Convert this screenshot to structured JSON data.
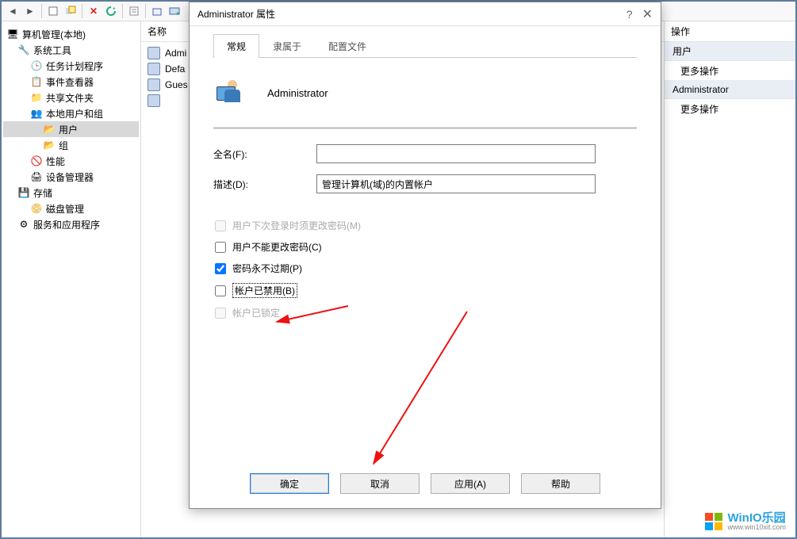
{
  "toolbar_icons": [
    "nav-back",
    "nav-fwd",
    "new",
    "overlay",
    "delete",
    "refresh",
    "prop",
    "export",
    "view",
    "help"
  ],
  "tree": {
    "root": "算机管理(本地)",
    "items": [
      {
        "label": "系统工具",
        "icon": "tools"
      },
      {
        "label": "任务计划程序",
        "icon": "clock"
      },
      {
        "label": "事件查看器",
        "icon": "event"
      },
      {
        "label": "共享文件夹",
        "icon": "share"
      },
      {
        "label": "本地用户和组",
        "icon": "users"
      },
      {
        "label": "用户",
        "icon": "folder",
        "selected": true
      },
      {
        "label": "组",
        "icon": "folder"
      },
      {
        "label": "性能",
        "icon": "perf"
      },
      {
        "label": "设备管理器",
        "icon": "device"
      },
      {
        "label": "存储",
        "icon": "storage"
      },
      {
        "label": "磁盘管理",
        "icon": "disk"
      },
      {
        "label": "服务和应用程序",
        "icon": "service"
      }
    ]
  },
  "center": {
    "header": "名称",
    "rows": [
      "Admi",
      "Defa",
      "Gues",
      ""
    ]
  },
  "right": {
    "header": "操作",
    "sec1": "用户",
    "link1": "更多操作",
    "sec2": "Administrator",
    "link2": "更多操作"
  },
  "dialog": {
    "title": "Administrator 属性",
    "tabs": [
      "常规",
      "隶属于",
      "配置文件"
    ],
    "active_tab": 0,
    "heading": "Administrator",
    "fields": {
      "fullname_label": "全名(F):",
      "fullname": "",
      "desc_label": "描述(D):",
      "desc": "管理计算机(域)的内置帐户"
    },
    "checks": {
      "c1": "用户下次登录时须更改密码(M)",
      "c2": "用户不能更改密码(C)",
      "c3": "密码永不过期(P)",
      "c4": "帐户已禁用(B)",
      "c5": "帐户已锁定"
    },
    "buttons": {
      "ok": "确定",
      "cancel": "取消",
      "apply": "应用(A)",
      "help": "帮助"
    }
  },
  "watermark": {
    "name": "WinIO乐园",
    "url": "www.win10xit.com"
  }
}
